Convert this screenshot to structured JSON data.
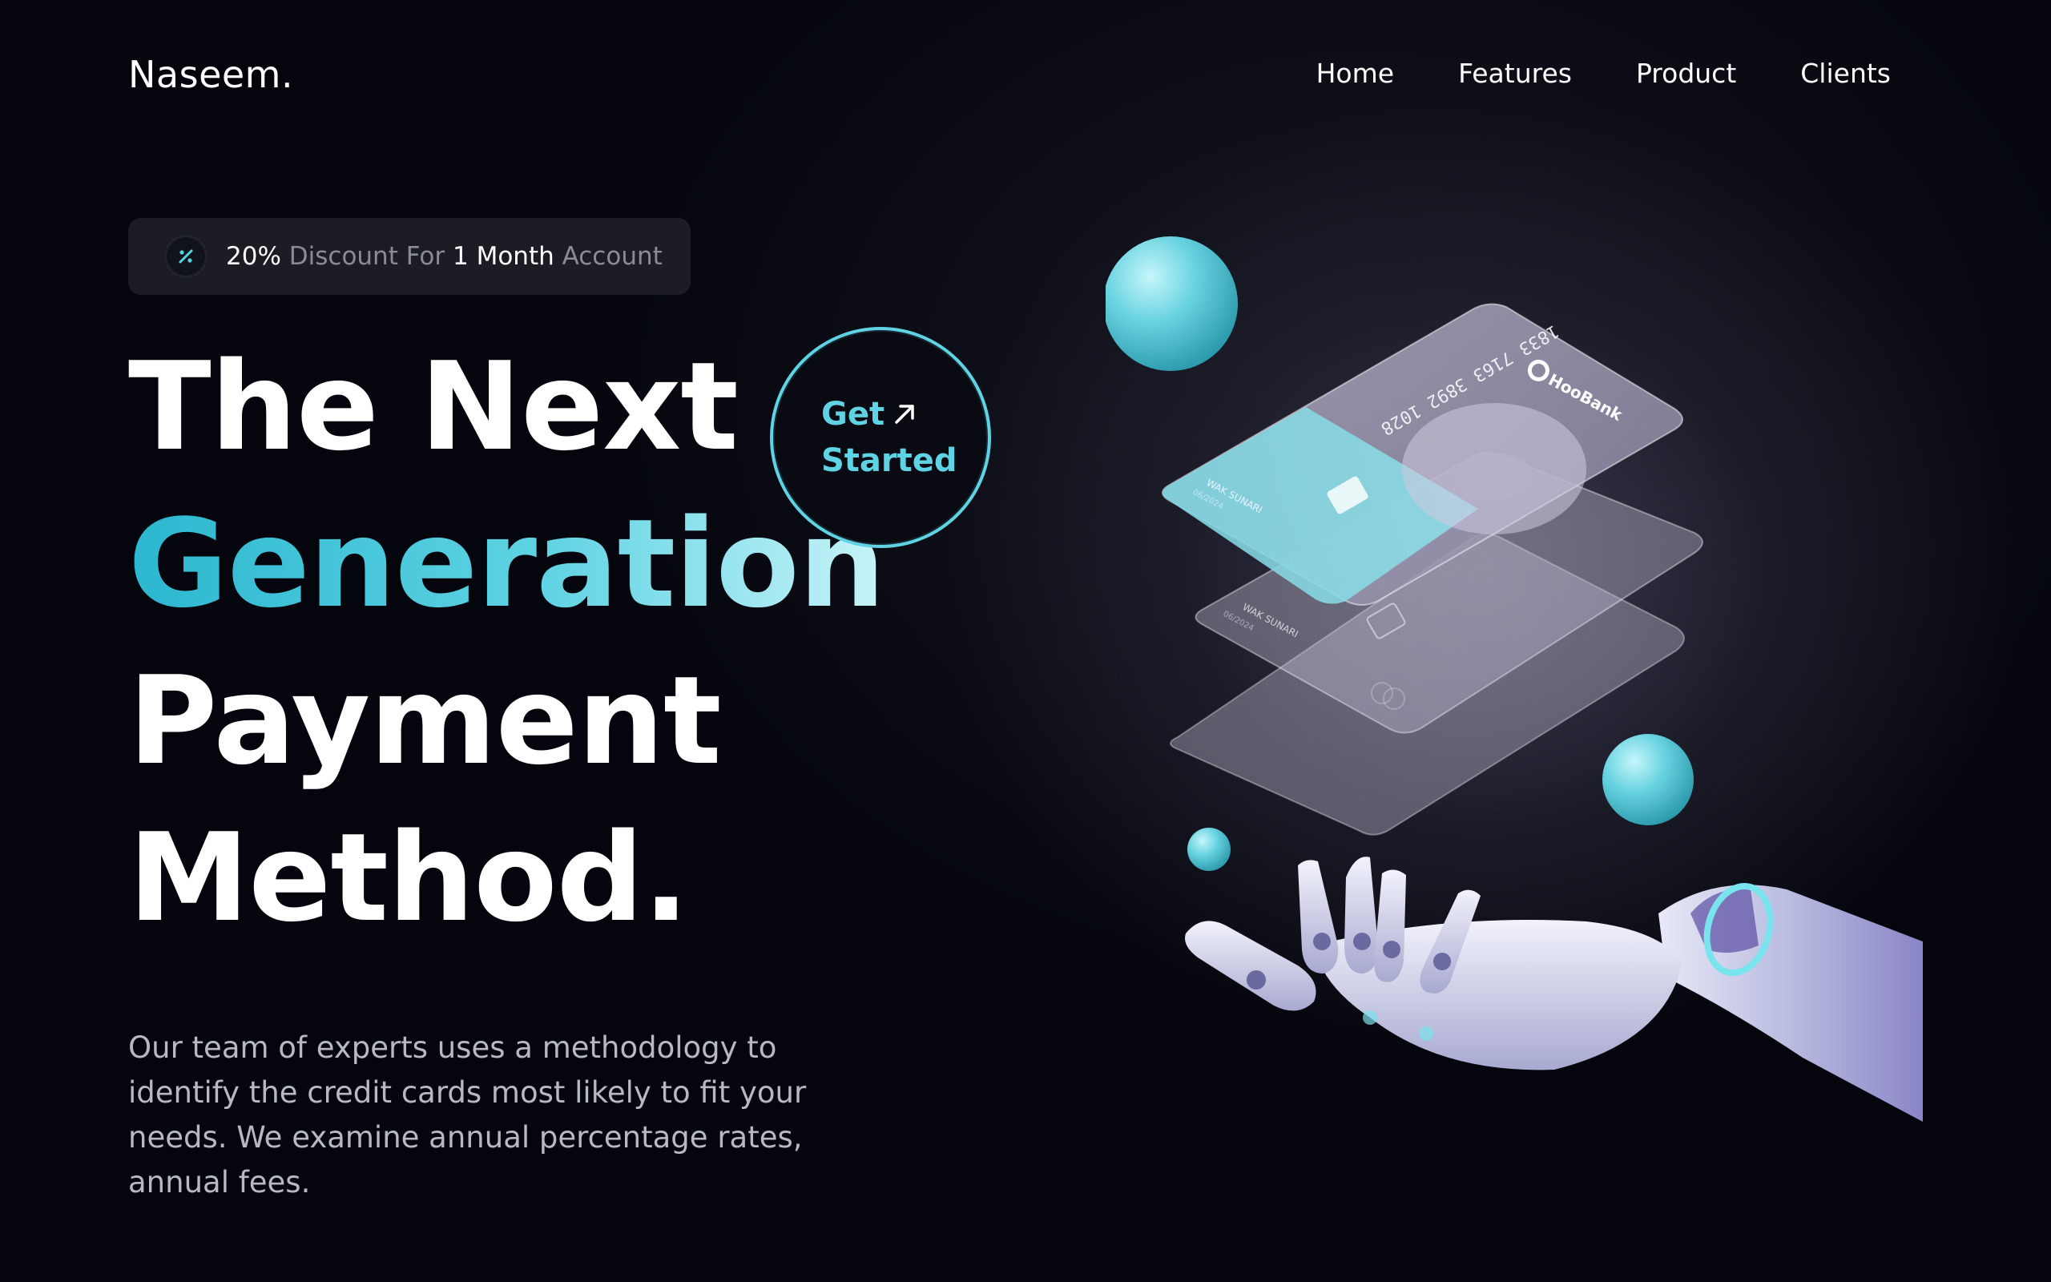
{
  "brand": {
    "logo": "Naseem."
  },
  "nav": {
    "items": [
      {
        "label": "Home"
      },
      {
        "label": "Features"
      },
      {
        "label": "Product"
      },
      {
        "label": "Clients"
      }
    ]
  },
  "badge": {
    "icon": "percent-icon",
    "pct": "20%",
    "text1": " Discount For ",
    "num": "1 Month",
    "text2": " Account"
  },
  "hero": {
    "line1": "The Next",
    "line2": "Generation",
    "line3": "Payment",
    "line4": "Method.",
    "cta_line1": "Get",
    "cta_line2": "Started",
    "cta_icon": "arrow-up-right-icon",
    "description": "Our team of experts uses a methodology to identify the credit cards most likely to fit your needs. We examine annual percentage rates, annual fees."
  },
  "card": {
    "number": "1833 7163 3892 1028",
    "brand": "HooBank",
    "holder": "WAK SUNARI",
    "expiry": "06/2024"
  },
  "colors": {
    "accent": "#5fd3e3",
    "background": "#05060d"
  }
}
